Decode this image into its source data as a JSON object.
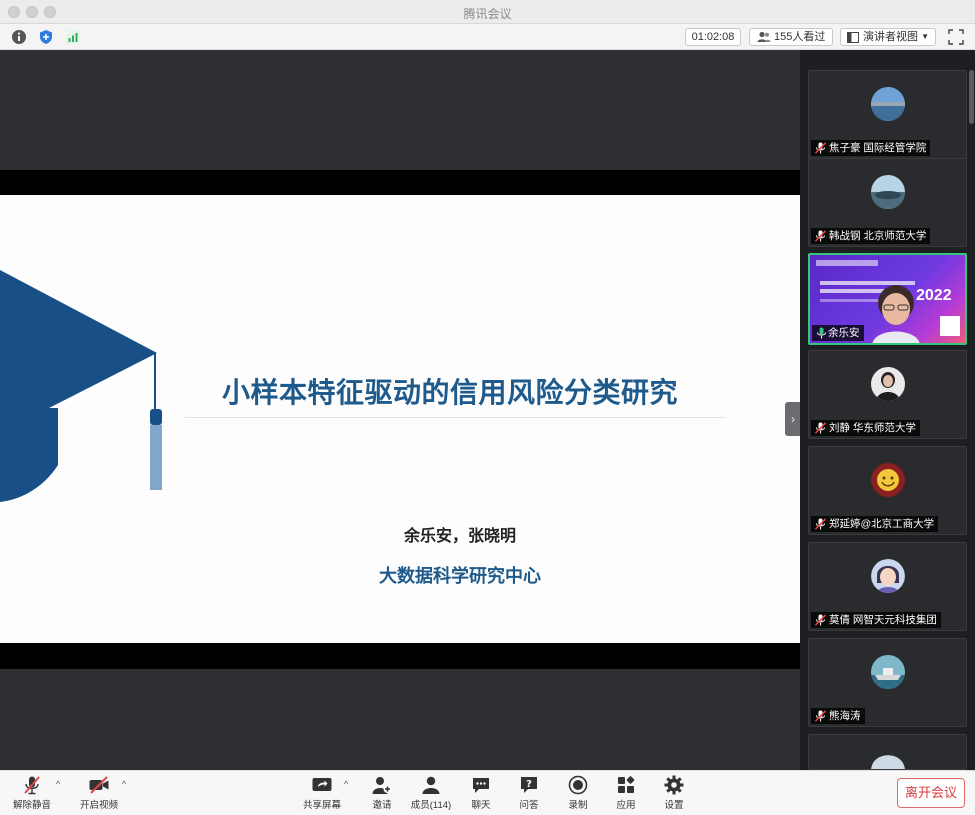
{
  "window": {
    "title": "腾讯会议"
  },
  "topbar": {
    "timer": "01:02:08",
    "viewers": "155人看过",
    "view_mode": "演讲者视图",
    "signal_icon": "signal-bars-icon",
    "colors": {
      "signal": "#2fb05c",
      "shield": "#2f7de1"
    }
  },
  "slide": {
    "title": "小样本特征驱动的信用风险分类研究",
    "authors": "余乐安，张晓明",
    "center": "大数据科学研究中心",
    "colors": {
      "primary": "#1e5a8c",
      "cap": "#174f86"
    }
  },
  "participants": [
    {
      "name": "焦子豪 国际经管学院",
      "muted": true,
      "avatar": "landscape"
    },
    {
      "name": "韩战钢 北京师范大学",
      "muted": true,
      "avatar": "landscape"
    },
    {
      "name": "余乐安",
      "muted": false,
      "active": true,
      "video": "2022"
    },
    {
      "name": "刘静 华东师范大学",
      "muted": true,
      "avatar": "person"
    },
    {
      "name": "郑延婷@北京工商大学",
      "muted": true,
      "avatar": "emblem"
    },
    {
      "name": "莫倩 网智天元科技集团",
      "muted": true,
      "avatar": "cartoon"
    },
    {
      "name": "熊海涛",
      "muted": true,
      "avatar": "ship"
    }
  ],
  "toolbar": {
    "unmute": "解除静音",
    "video": "开启视频",
    "share": "共享屏幕",
    "invite": "邀请",
    "members": "成员(114)",
    "chat": "聊天",
    "qa": "问答",
    "record": "录制",
    "apps": "应用",
    "settings": "设置",
    "leave": "离开会议"
  },
  "accent_colors": {
    "muted": "#e04848",
    "leave": "#d63b3b",
    "speaking": "#36c57a"
  }
}
